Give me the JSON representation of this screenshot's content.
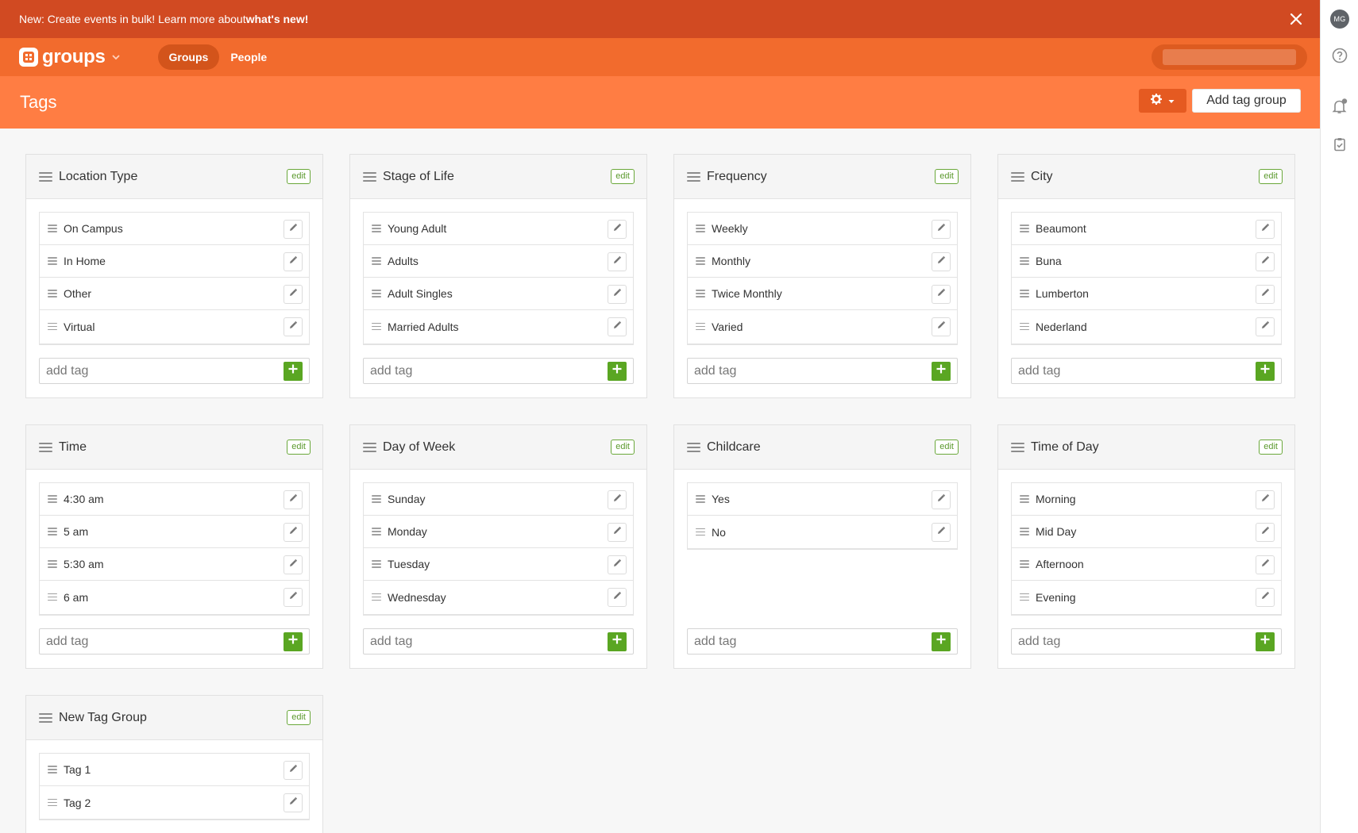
{
  "announcement": {
    "text": "New: Create events in bulk! Learn more about ",
    "link": "what's new!"
  },
  "nav": {
    "app_name": "groups",
    "tabs": [
      {
        "label": "Groups",
        "active": true
      },
      {
        "label": "People",
        "active": false
      }
    ]
  },
  "user": {
    "initials": "MG"
  },
  "page": {
    "title": "Tags",
    "add_group_label": "Add tag group"
  },
  "add_tag_placeholder": "add tag",
  "edit_label": "edit",
  "tag_groups": [
    {
      "title": "Location Type",
      "tags": [
        "On Campus",
        "In Home",
        "Other",
        "Virtual"
      ]
    },
    {
      "title": "Stage of Life",
      "tags": [
        "Young Adult",
        "Adults",
        "Adult Singles",
        "Married Adults"
      ]
    },
    {
      "title": "Frequency",
      "tags": [
        "Weekly",
        "Monthly",
        "Twice Monthly",
        "Varied"
      ]
    },
    {
      "title": "City",
      "tags": [
        "Beaumont",
        "Buna",
        "Lumberton",
        "Nederland"
      ]
    },
    {
      "title": "Time",
      "tags": [
        "4:30 am",
        "5 am",
        "5:30 am",
        "6 am"
      ]
    },
    {
      "title": "Day of Week",
      "tags": [
        "Sunday",
        "Monday",
        "Tuesday",
        "Wednesday"
      ]
    },
    {
      "title": "Childcare",
      "tags": [
        "Yes",
        "No"
      ]
    },
    {
      "title": "Time of Day",
      "tags": [
        "Morning",
        "Mid Day",
        "Afternoon",
        "Evening"
      ]
    },
    {
      "title": "New Tag Group",
      "tags": [
        "Tag 1",
        "Tag 2"
      ]
    }
  ],
  "colors": {
    "announce_bg": "#d14a22",
    "nav_bg": "#f26b2d",
    "header_bg": "#ff7d43",
    "accent_green": "#5aa622"
  }
}
